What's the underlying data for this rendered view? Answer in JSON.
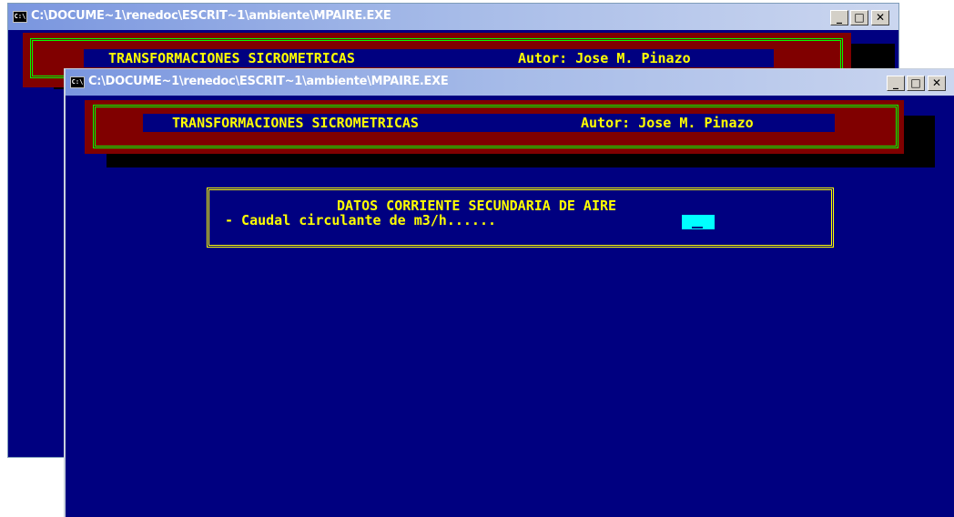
{
  "windows": [
    {
      "title": "C:\\DOCUME~1\\renedoc\\ESCRIT~1\\ambiente\\MPAIRE.EXE",
      "icon_label": "C:\\",
      "controls": {
        "minimize": "_",
        "maximize": "□",
        "close": "✕"
      },
      "header": {
        "title": "TRANSFORMACIONES SICROMETRICAS",
        "author": "Autor: Jose M. Pinazo"
      }
    },
    {
      "title": "C:\\DOCUME~1\\renedoc\\ESCRIT~1\\ambiente\\MPAIRE.EXE",
      "icon_label": "C:\\",
      "controls": {
        "minimize": "_",
        "maximize": "□",
        "close": "✕"
      },
      "header": {
        "title": "TRANSFORMACIONES SICROMETRICAS",
        "author": "Autor: Jose M. Pinazo"
      },
      "dialog": {
        "heading": "DATOS CORRIENTE SECUNDARIA DE AIRE",
        "prompt": "- Caudal circulante de m3/h......",
        "value": ""
      }
    }
  ],
  "colors": {
    "console_bg": "#000080",
    "banner_bg": "#800000",
    "banner_border": "#00ff00",
    "text": "#ffff00",
    "input_bg": "#00ffff"
  }
}
